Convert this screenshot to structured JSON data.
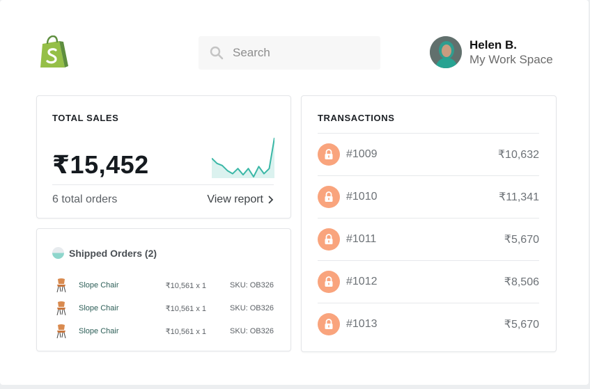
{
  "header": {
    "logo": "shopify-bag-logo",
    "search": {
      "placeholder": "Search",
      "icon": "search-icon"
    },
    "user": {
      "name": "Helen B.",
      "workspace": "My Work Space"
    }
  },
  "sales": {
    "title": "TOTAL SALES",
    "value": "₹15,452",
    "orders_text": "6 total orders",
    "view_report": "View report",
    "sparkline": {
      "type": "line",
      "values": [
        30,
        25,
        23,
        18,
        15,
        20,
        14,
        20,
        12,
        22,
        15,
        20,
        50
      ],
      "color": "#3ab7a6"
    }
  },
  "shipped": {
    "label": "Shipped Orders (2)",
    "items": [
      {
        "name": "Slope Chair",
        "qty": "₹10,561 x 1",
        "sku": "SKU: OB326"
      },
      {
        "name": "Slope Chair",
        "qty": "₹10,561 x 1",
        "sku": "SKU: OB326"
      },
      {
        "name": "Slope Chair",
        "qty": "₹10,561 x 1",
        "sku": "SKU: OB326"
      }
    ]
  },
  "transactions": {
    "title": "TRANSACTIONS",
    "items": [
      {
        "id": "#1009",
        "amount": "₹10,632"
      },
      {
        "id": "#1010",
        "amount": "₹11,341"
      },
      {
        "id": "#1011",
        "amount": "₹5,670"
      },
      {
        "id": "#1012",
        "amount": "₹8,506"
      },
      {
        "id": "#1013",
        "amount": "₹5,670"
      }
    ]
  },
  "colors": {
    "accent": "#3ab7a6",
    "lock_badge": "#f9a47d",
    "logo_green": "#95bf47"
  }
}
